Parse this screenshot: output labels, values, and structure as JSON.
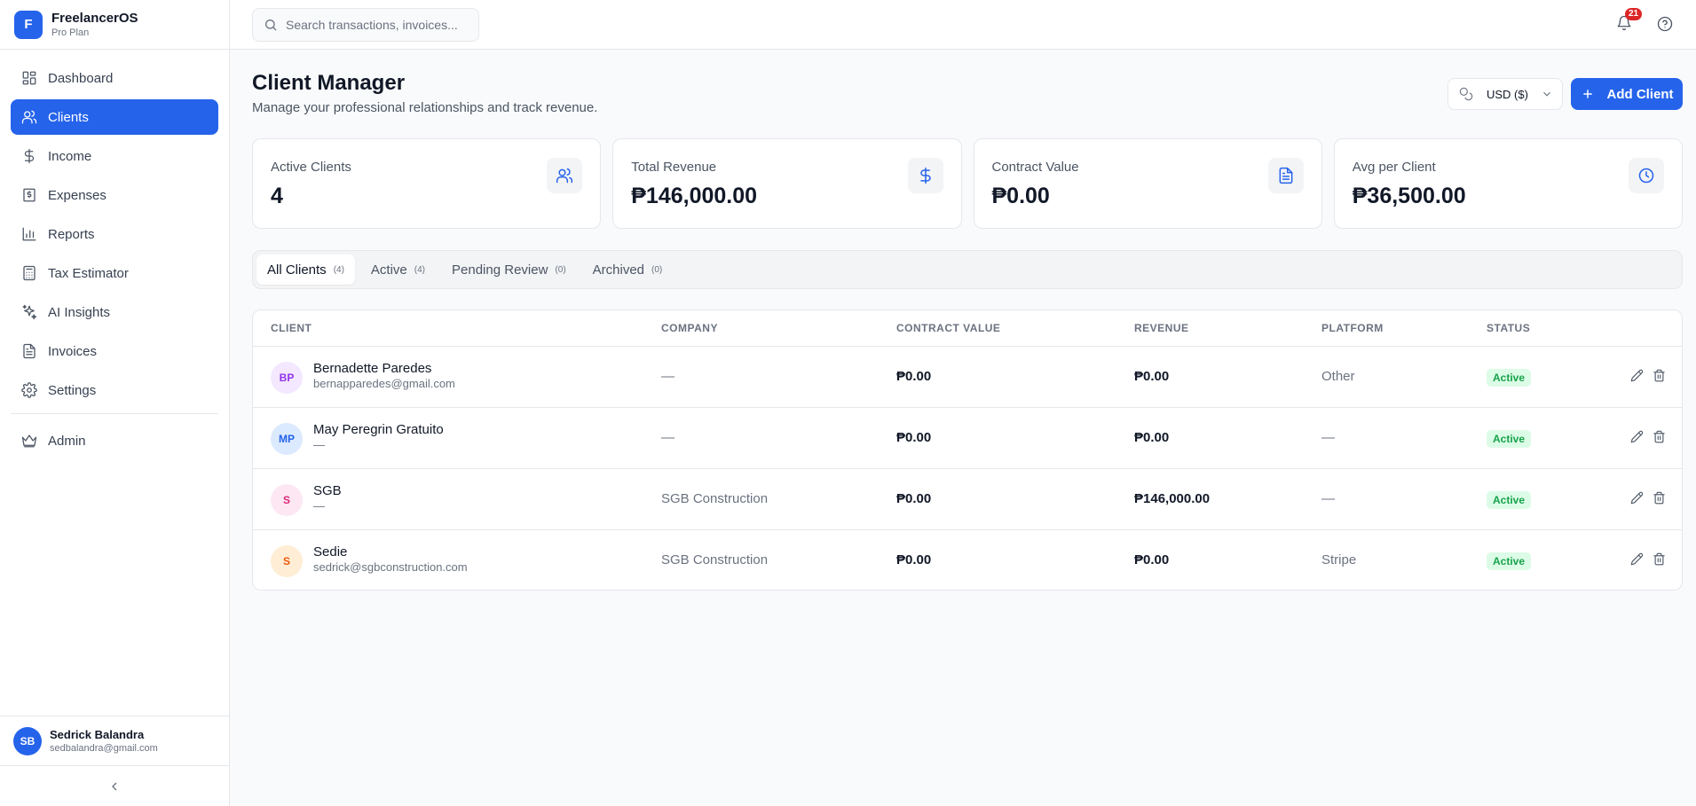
{
  "brand": {
    "logo_letter": "F",
    "name": "FreelancerOS",
    "plan": "Pro Plan"
  },
  "sidebar": {
    "items": [
      {
        "label": "Dashboard",
        "icon": "dashboard-icon",
        "active": false
      },
      {
        "label": "Clients",
        "icon": "users-icon",
        "active": true
      },
      {
        "label": "Income",
        "icon": "dollar-icon",
        "active": false
      },
      {
        "label": "Expenses",
        "icon": "receipt-icon",
        "active": false
      },
      {
        "label": "Reports",
        "icon": "bar-chart-icon",
        "active": false
      },
      {
        "label": "Tax Estimator",
        "icon": "calculator-icon",
        "active": false
      },
      {
        "label": "AI Insights",
        "icon": "sparkles-icon",
        "active": false
      },
      {
        "label": "Invoices",
        "icon": "file-text-icon",
        "active": false
      },
      {
        "label": "Settings",
        "icon": "gear-icon",
        "active": false
      }
    ],
    "admin": {
      "label": "Admin",
      "icon": "crown-icon"
    }
  },
  "user": {
    "initials": "SB",
    "name": "Sedrick Balandra",
    "email": "sedbalandra@gmail.com"
  },
  "topbar": {
    "search_placeholder": "Search transactions, invoices...",
    "notification_count": "21"
  },
  "header": {
    "title": "Client Manager",
    "subtitle": "Manage your professional relationships and track revenue.",
    "currency": "USD ($)",
    "add_button": "Add Client"
  },
  "stats": [
    {
      "label": "Active Clients",
      "value": "4",
      "icon": "users-icon"
    },
    {
      "label": "Total Revenue",
      "value": "₱146,000.00",
      "icon": "dollar-icon"
    },
    {
      "label": "Contract Value",
      "value": "₱0.00",
      "icon": "file-text-icon"
    },
    {
      "label": "Avg per Client",
      "value": "₱36,500.00",
      "icon": "clock-icon"
    }
  ],
  "tabs": [
    {
      "label": "All Clients",
      "count": "(4)",
      "active": true
    },
    {
      "label": "Active",
      "count": "(4)",
      "active": false
    },
    {
      "label": "Pending Review",
      "count": "(0)",
      "active": false
    },
    {
      "label": "Archived",
      "count": "(0)",
      "active": false
    }
  ],
  "table": {
    "headers": {
      "client": "CLIENT",
      "company": "COMPANY",
      "contract": "CONTRACT VALUE",
      "revenue": "REVENUE",
      "platform": "PLATFORM",
      "status": "STATUS"
    },
    "rows": [
      {
        "initials": "BP",
        "avatar_bg": "#f3e8ff",
        "avatar_fg": "#9333ea",
        "name": "Bernadette Paredes",
        "email": "bernapparedes@gmail.com",
        "company": "—",
        "contract": "₱0.00",
        "revenue": "₱0.00",
        "platform": "Other",
        "status": "Active"
      },
      {
        "initials": "MP",
        "avatar_bg": "#dbeafe",
        "avatar_fg": "#2563eb",
        "name": "May Peregrin Gratuito",
        "email": "—",
        "company": "—",
        "contract": "₱0.00",
        "revenue": "₱0.00",
        "platform": "—",
        "status": "Active"
      },
      {
        "initials": "S",
        "avatar_bg": "#fce7f3",
        "avatar_fg": "#db2777",
        "name": "SGB",
        "email": "—",
        "company": "SGB Construction",
        "contract": "₱0.00",
        "revenue": "₱146,000.00",
        "platform": "—",
        "status": "Active"
      },
      {
        "initials": "S",
        "avatar_bg": "#ffedd5",
        "avatar_fg": "#ea580c",
        "name": "Sedie",
        "email": "sedrick@sgbconstruction.com",
        "company": "SGB Construction",
        "contract": "₱0.00",
        "revenue": "₱0.00",
        "platform": "Stripe",
        "status": "Active"
      }
    ]
  }
}
